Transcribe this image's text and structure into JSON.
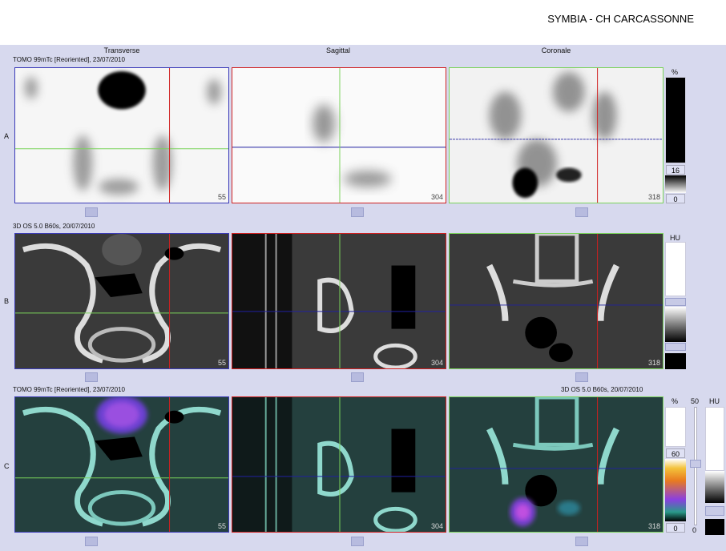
{
  "header": {
    "site": "SYMBIA - CH CARCASSONNE"
  },
  "columns": [
    "Transverse",
    "Sagittal",
    "Coronale"
  ],
  "rows": {
    "a": {
      "label": "A",
      "series": "TOMO 99mTc [Reoriented], 23/07/2010",
      "slices": [
        "55",
        "304",
        "318"
      ],
      "unit": "%",
      "scale_top": "16",
      "scale_bottom": "0"
    },
    "b": {
      "label": "B",
      "series": "3D  OS  5.0  B60s, 20/07/2010",
      "slices": [
        "55",
        "304",
        "318"
      ],
      "unit": "HU"
    },
    "c": {
      "label": "C",
      "series_left": "TOMO 99mTc [Reoriented], 23/07/2010",
      "series_right": "3D  OS  5.0  B60s, 20/07/2010",
      "slices": [
        "55",
        "304",
        "318"
      ],
      "unit": "%",
      "scale_top": "60",
      "scale_bottom": "0",
      "scale2_label": "50",
      "scale2_unit": "HU",
      "scale2_bottom": "0"
    }
  },
  "colors": {
    "transverse_border": "#3b3bb8",
    "sagittal_border": "#d02020",
    "coronal_border": "#7ad35a"
  }
}
